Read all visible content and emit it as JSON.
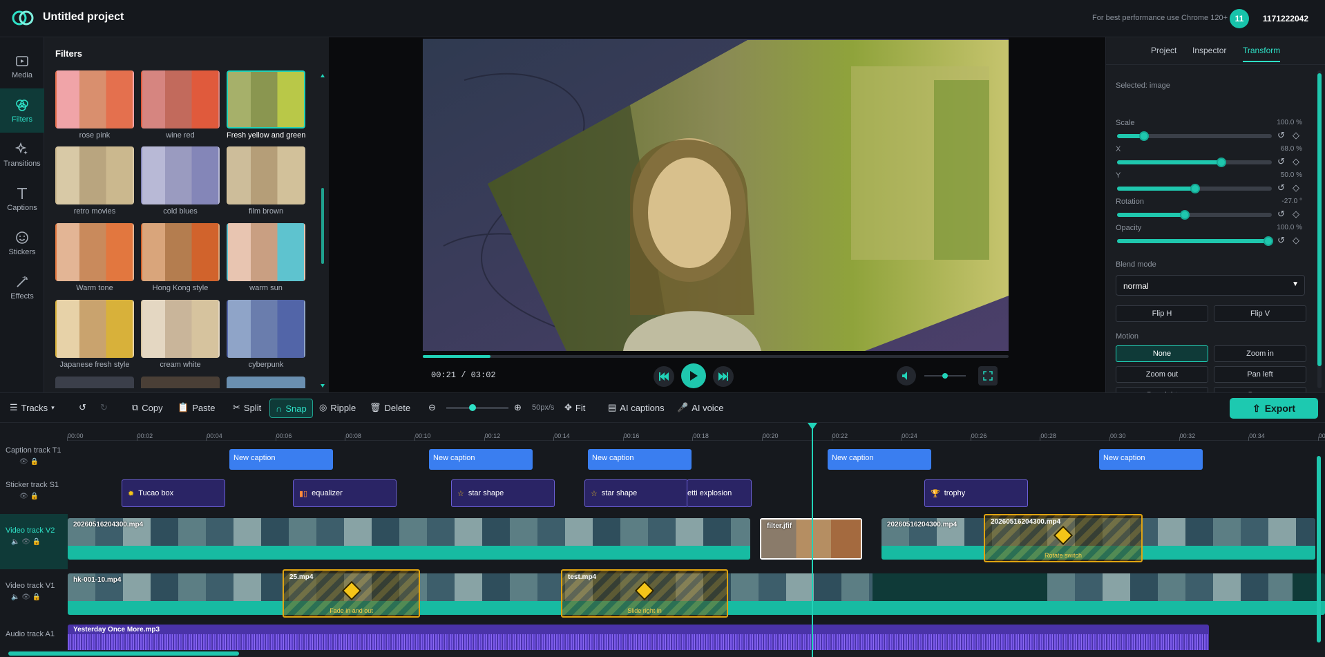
{
  "header": {
    "title": "Untitled project",
    "perf_note": "For best performance use Chrome 120+",
    "avatar_initials": "11",
    "user_id": "1171222042"
  },
  "nav": [
    {
      "label": "Media",
      "icon": "media-icon"
    },
    {
      "label": "Filters",
      "icon": "filters-icon"
    },
    {
      "label": "Transitions",
      "icon": "transitions-icon"
    },
    {
      "label": "Captions",
      "icon": "captions-icon"
    },
    {
      "label": "Stickers",
      "icon": "stickers-icon"
    },
    {
      "label": "Effects",
      "icon": "effects-icon"
    }
  ],
  "filters": {
    "title": "Filters",
    "items": [
      {
        "label": "rose pink"
      },
      {
        "label": "wine red"
      },
      {
        "label": "Fresh yellow and green"
      },
      {
        "label": "retro movies"
      },
      {
        "label": "cold blues"
      },
      {
        "label": "film brown"
      },
      {
        "label": "Warm tone"
      },
      {
        "label": "Hong Kong style"
      },
      {
        "label": "warm sun"
      },
      {
        "label": "Japanese fresh style"
      },
      {
        "label": "cream white"
      },
      {
        "label": "cyberpunk"
      }
    ]
  },
  "player": {
    "timecode": "00:21 / 03:02",
    "progress": 0.115,
    "volume": 0.5
  },
  "inspector": {
    "tabs": [
      "Project",
      "Inspector",
      "Transform"
    ],
    "selected": "Selected: image",
    "props": [
      {
        "name": "Scale",
        "value": "100.0 %",
        "level": 0.15
      },
      {
        "name": "X",
        "value": "68.0 %",
        "level": 0.68
      },
      {
        "name": "Y",
        "value": "50.0 %",
        "level": 0.5
      },
      {
        "name": "Rotation",
        "value": "-27.0 °",
        "level": 0.43
      },
      {
        "name": "Opacity",
        "value": "100.0 %",
        "level": 1.0
      }
    ],
    "blend_label": "Blend mode",
    "blend_value": "normal",
    "flip_h": "Flip H",
    "flip_v": "Flip V",
    "motion_label": "Motion",
    "motion": [
      "None",
      "Zoom in",
      "Zoom out",
      "Pan left",
      "Pan right",
      "Pan up"
    ]
  },
  "toolbar": {
    "tracks": "Tracks",
    "copy": "Copy",
    "paste": "Paste",
    "split": "Split",
    "snap": "Snap",
    "ripple": "Ripple",
    "delete": "Delete",
    "zoom": "50px/s",
    "fit": "Fit",
    "ai_captions": "AI captions",
    "ai_voice": "AI voice",
    "export": "Export"
  },
  "ruler": [
    "00:00",
    "00:02",
    "00:04",
    "00:06",
    "00:08",
    "00:10",
    "00:12",
    "00:14",
    "00:16",
    "00:18",
    "00:20",
    "00:22",
    "00:24",
    "00:26",
    "00:28",
    "00:30",
    "00:32",
    "00:34",
    "00:3"
  ],
  "tracks": {
    "caption": "Caption track T1",
    "sticker": "Sticker track S1",
    "v2": "Video track V2",
    "v1": "Video track V1",
    "audio": "Audio track A1"
  },
  "captions": [
    "New caption",
    "New caption",
    "New caption",
    "New caption",
    "New caption"
  ],
  "stickers": [
    {
      "label": "Tucao box",
      "icon": "star-burst-icon"
    },
    {
      "label": "equalizer",
      "icon": "equalizer-icon"
    },
    {
      "label": "star shape",
      "icon": "star-icon"
    },
    {
      "label": "star shape",
      "icon": "star-icon"
    },
    {
      "label": "etti explosion",
      "icon": "confetti-icon"
    },
    {
      "label": "trophy",
      "icon": "trophy-icon"
    }
  ],
  "v2clips": [
    "20260516204300.mp4",
    "filter.jfif",
    "20260516204300.mp4",
    "20260516204300.mp4"
  ],
  "v2trans": "Rotate switch",
  "v1clips": [
    "hk-001-10.mp4",
    "25.mp4",
    "test.mp4"
  ],
  "v1trans": [
    "Fade in and out",
    "Slide right in"
  ],
  "audio": "Yesterday Once More.mp3",
  "colors": {
    "accent": "#1dc9b0",
    "caption": "#3a7ef0",
    "sticker": "#2a2465",
    "audio": "#4a33a8",
    "transition": "#e0a411"
  }
}
